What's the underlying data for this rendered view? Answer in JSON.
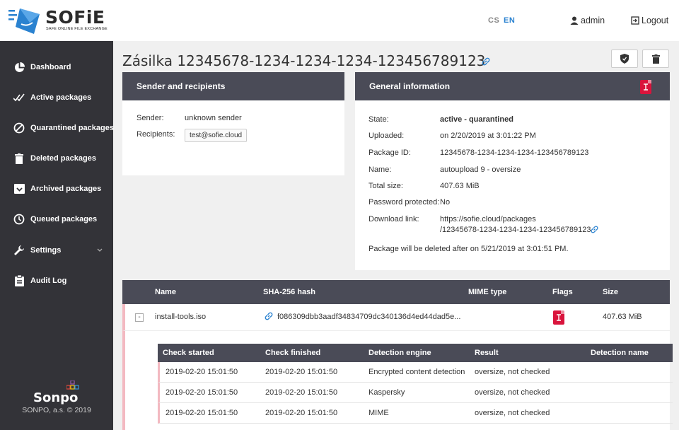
{
  "brand": {
    "name": "SOFiE",
    "tagline": "SAFE ONLINE FILE EXCHANGE"
  },
  "header": {
    "lang_cs": "CS",
    "lang_en": "EN",
    "user": "admin",
    "logout": "Logout"
  },
  "sidebar": {
    "items": [
      {
        "label": "Dashboard",
        "icon": "pie-chart-icon"
      },
      {
        "label": "Active packages",
        "icon": "double-check-icon"
      },
      {
        "label": "Quarantined packages",
        "icon": "ban-icon"
      },
      {
        "label": "Deleted packages",
        "icon": "trash-icon"
      },
      {
        "label": "Archived packages",
        "icon": "archive-icon"
      },
      {
        "label": "Queued packages",
        "icon": "clock-icon"
      },
      {
        "label": "Settings",
        "icon": "wrench-icon"
      },
      {
        "label": "Audit Log",
        "icon": "clipboard-icon"
      }
    ],
    "company": "Sonpo",
    "copyright": "SONPO, a.s. © 2019"
  },
  "page": {
    "title": "Zásilka 12345678-1234-1234-1234-123456789123"
  },
  "sender_panel": {
    "title": "Sender and recipients",
    "sender_label": "Sender:",
    "sender_value": "unknown sender",
    "recipients_label": "Recipients:",
    "recipients": [
      "test@sofie.cloud"
    ]
  },
  "general_panel": {
    "title": "General information",
    "rows": [
      {
        "label": "State:",
        "value": "active - quarantined"
      },
      {
        "label": "Uploaded:",
        "value": "on 2/20/2019 at 3:01:22 PM"
      },
      {
        "label": "Package ID:",
        "value": "12345678-1234-1234-1234-123456789123"
      },
      {
        "label": "Name:",
        "value": "autoupload 9 - oversize"
      },
      {
        "label": "Total size:",
        "value": "407.63 MiB"
      },
      {
        "label": "Password protected:",
        "value": "No"
      }
    ],
    "download_label": "Download link:",
    "download_line1": "https://sofie.cloud/packages",
    "download_line2": "/12345678-1234-1234-1234-123456789123",
    "deletion_note": "Package will be deleted after on 5/21/2019 at 3:01:51 PM."
  },
  "files_table": {
    "headers": {
      "name": "Name",
      "hash": "SHA-256 hash",
      "mime": "MIME type",
      "flags": "Flags",
      "size": "Size"
    },
    "row": {
      "toggle": "-",
      "name": "install-tools.iso",
      "hash": "f086309dbb3aadf34834709dc340136d4ed44dad5e...",
      "mime": "",
      "size": "407.63 MiB"
    }
  },
  "checks_table": {
    "headers": {
      "started": "Check started",
      "finished": "Check finished",
      "engine": "Detection engine",
      "result": "Result",
      "detection": "Detection name"
    },
    "rows": [
      {
        "started": "2019-02-20 15:01:50",
        "finished": "2019-02-20 15:01:50",
        "engine": "Encrypted content detection",
        "result": "oversize, not checked",
        "detection": ""
      },
      {
        "started": "2019-02-20 15:01:50",
        "finished": "2019-02-20 15:01:50",
        "engine": "Kaspersky",
        "result": "oversize, not checked",
        "detection": ""
      },
      {
        "started": "2019-02-20 15:01:50",
        "finished": "2019-02-20 15:01:50",
        "engine": "MIME",
        "result": "oversize, not checked",
        "detection": ""
      }
    ]
  },
  "colors": {
    "sidebar": "#333338",
    "panel_header": "#4a4b57",
    "accent": "#2a82d0",
    "flag": "#d9143c"
  }
}
